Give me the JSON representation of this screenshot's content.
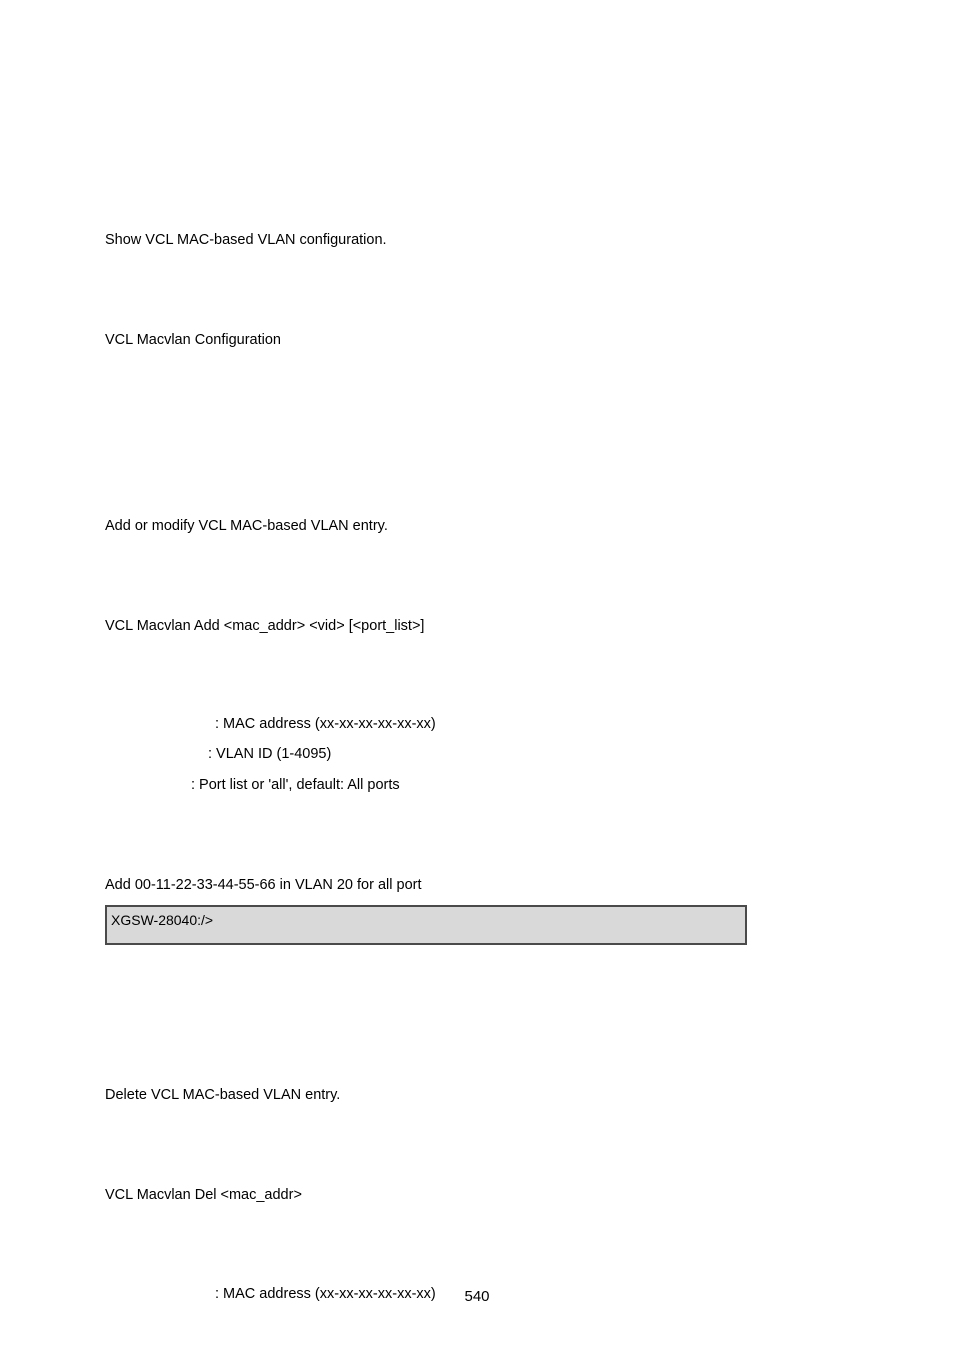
{
  "section1": {
    "desc": "Show VCL MAC-based VLAN configuration.",
    "syntax": "VCL Macvlan Configuration"
  },
  "section2": {
    "desc": "Add or modify VCL MAC-based VLAN entry.",
    "syntax": "VCL Macvlan Add <mac_addr> <vid> [<port_list>]",
    "params": {
      "mac": ": MAC address (xx-xx-xx-xx-xx-xx)",
      "vid": ": VLAN ID (1-4095)",
      "ports": ": Port list or 'all', default: All ports"
    },
    "example_label": "Add 00-11-22-33-44-55-66 in VLAN 20 for all port",
    "terminal": "XGSW-28040:/>"
  },
  "section3": {
    "desc": "Delete VCL MAC-based VLAN entry.",
    "syntax": "VCL Macvlan Del <mac_addr>",
    "params": {
      "mac": ": MAC address (xx-xx-xx-xx-xx-xx)"
    }
  },
  "page_number": "540"
}
